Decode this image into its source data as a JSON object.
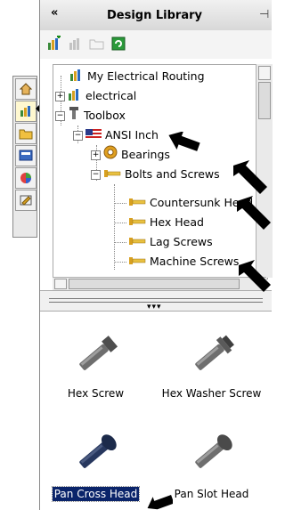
{
  "panel": {
    "title": "Design Library",
    "collapse": "«",
    "pin": "⊣"
  },
  "tree": {
    "items": [
      {
        "label": "My Electrical Routing",
        "icon": "library-folder-icon"
      },
      {
        "label": "electrical",
        "icon": "library-folder-icon",
        "expander": "+"
      },
      {
        "label": "Toolbox",
        "icon": "toolbox-icon",
        "expander": "−"
      },
      {
        "label": "ANSI Inch",
        "icon": "us-flag-icon",
        "expander": "−"
      },
      {
        "label": "Bearings",
        "icon": "bearing-icon",
        "expander": "+"
      },
      {
        "label": "Bolts and Screws",
        "icon": "bolt-folder-icon",
        "expander": "−"
      },
      {
        "label": "Countersunk Head",
        "icon": "bolt-folder-icon"
      },
      {
        "label": "Hex Head",
        "icon": "bolt-folder-icon"
      },
      {
        "label": "Lag Screws",
        "icon": "bolt-folder-icon"
      },
      {
        "label": "Machine Screws",
        "icon": "bolt-folder-icon"
      }
    ]
  },
  "gallery": {
    "items": [
      {
        "label": "Hex Screw",
        "selected": false
      },
      {
        "label": "Hex Washer Screw",
        "selected": false
      },
      {
        "label": "Pan Cross Head",
        "selected": true
      },
      {
        "label": "Pan Slot Head",
        "selected": false
      }
    ]
  },
  "colors": {
    "selection": "#0a246a",
    "screw_gray": "#6e6e6e",
    "screw_blue": "#27375e"
  }
}
